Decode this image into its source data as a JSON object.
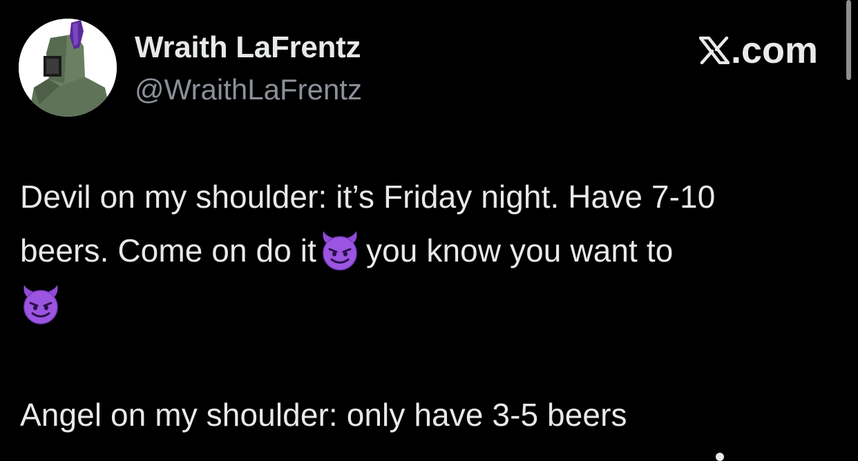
{
  "author": {
    "display_name": "Wraith LaFrentz",
    "handle": "@WraithLaFrentz",
    "avatar": "knight-helmet-avatar"
  },
  "site": {
    "logo_suffix": ".com"
  },
  "tweet": {
    "line1": "Devil on my shoulder: it’s Friday night. Have 7-10",
    "line2_before_emoji": "beers. Come on do it",
    "line2_after_emoji": "you know you want to",
    "emoji": "smiling-face-with-horns",
    "line3": "Angel on my shoulder: only have 3-5 beers"
  },
  "colors": {
    "background": "#000000",
    "text": "#e7e9ea",
    "secondary_text": "#8b9098",
    "emoji_purple": "#8e4bd6"
  }
}
